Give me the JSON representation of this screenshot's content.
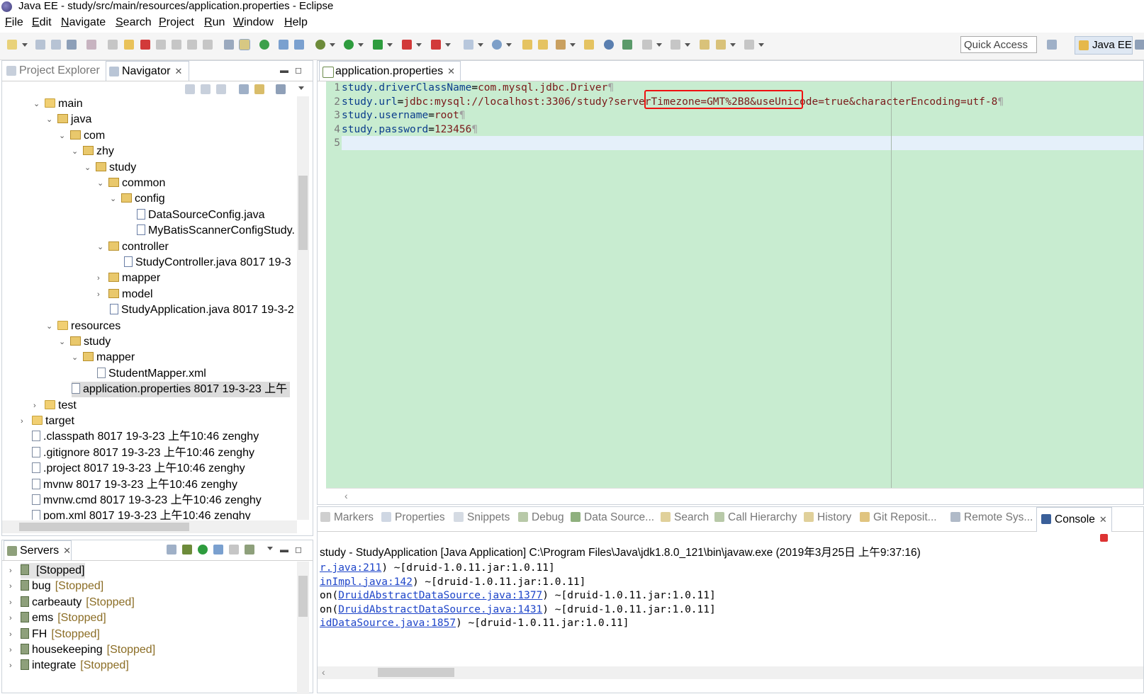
{
  "window": {
    "title": "Java EE - study/src/main/resources/application.properties - Eclipse"
  },
  "menu": [
    "File",
    "Edit",
    "Navigate",
    "Search",
    "Project",
    "Run",
    "Window",
    "Help"
  ],
  "toolbar": {
    "quick_access": "Quick Access",
    "perspective": "Java EE"
  },
  "nav": {
    "tabs": {
      "project_explorer": "Project Explorer",
      "navigator": "Navigator"
    },
    "tree": [
      {
        "label": "main",
        "tw": "v"
      },
      {
        "label": "java",
        "tw": "v"
      },
      {
        "label": "com",
        "tw": "v"
      },
      {
        "label": "zhy",
        "tw": "v"
      },
      {
        "label": "study",
        "tw": "v"
      },
      {
        "label": "common",
        "tw": "v"
      },
      {
        "label": "config",
        "tw": "v"
      },
      {
        "label": "DataSourceConfig.java",
        "tw": ""
      },
      {
        "label": "MyBatisScannerConfigStudy.",
        "tw": ""
      },
      {
        "label": "controller",
        "tw": "v"
      },
      {
        "label": "StudyController.java 8017  19-3",
        "tw": ""
      },
      {
        "label": "mapper",
        "tw": ">"
      },
      {
        "label": "model",
        "tw": ">"
      },
      {
        "label": "StudyApplication.java 8017  19-3-2",
        "tw": ""
      },
      {
        "label": "resources",
        "tw": "v"
      },
      {
        "label": "study",
        "tw": "v"
      },
      {
        "label": "mapper",
        "tw": "v"
      },
      {
        "label": "StudentMapper.xml",
        "tw": ""
      },
      {
        "label": "application.properties 8017  19-3-23 上午",
        "tw": ""
      },
      {
        "label": "test",
        "tw": ">"
      },
      {
        "label": "target",
        "tw": ">"
      },
      {
        "label": ".classpath 8017  19-3-23 上午10:46  zenghy",
        "tw": ""
      },
      {
        "label": ".gitignore 8017  19-3-23 上午10:46  zenghy",
        "tw": ""
      },
      {
        "label": ".project 8017  19-3-23 上午10:46  zenghy",
        "tw": ""
      },
      {
        "label": "mvnw 8017  19-3-23 上午10:46  zenghy",
        "tw": ""
      },
      {
        "label": "mvnw.cmd 8017  19-3-23 上午10:46  zenghy",
        "tw": ""
      },
      {
        "label": "pom.xml 8017  19-3-23 上午10:46  zenghy",
        "tw": ""
      }
    ]
  },
  "servers": {
    "tab": "Servers",
    "items": [
      {
        "name": "",
        "status": "[Stopped]"
      },
      {
        "name": "bug",
        "status": "[Stopped]"
      },
      {
        "name": "carbeauty",
        "status": "[Stopped]"
      },
      {
        "name": "ems",
        "status": "[Stopped]"
      },
      {
        "name": "FH",
        "status": "[Stopped]"
      },
      {
        "name": "housekeeping",
        "status": "[Stopped]"
      },
      {
        "name": "integrate",
        "status": "[Stopped]"
      }
    ]
  },
  "editor": {
    "tab": "application.properties",
    "lines": [
      {
        "n": "1",
        "key": "study.driverClassName",
        "eq": "=",
        "val": "com.mysql.jdbc.Driver",
        "p": "¶"
      },
      {
        "n": "2",
        "key": "study.url",
        "eq": "=",
        "val": "jdbc:mysql://localhost:3306/study?serverTimezone=GMT%2B8&useUnicode=true&characterEncoding=utf-8",
        "p": "¶"
      },
      {
        "n": "3",
        "key": "study.username",
        "eq": "=",
        "val": "root",
        "p": "¶"
      },
      {
        "n": "4",
        "key": "study.password",
        "eq": "=",
        "val": "123456",
        "p": "¶"
      },
      {
        "n": "5",
        "key": "",
        "eq": "",
        "val": "",
        "p": ""
      }
    ]
  },
  "bottom": {
    "tabs": [
      "Markers",
      "Properties",
      "Snippets",
      "Debug",
      "Data Source...",
      "Search",
      "Call Hierarchy",
      "History",
      "Git Reposit...",
      "Remote Sys..."
    ],
    "console_tab": "Console",
    "header": "study - StudyApplication [Java Application] C:\\Program Files\\Java\\jdk1.8.0_121\\bin\\javaw.exe (2019年3月25日 上午9:37:16)",
    "lines": [
      {
        "pre": "",
        "link": "r.java:211",
        "post": ") ~[druid-1.0.11.jar:1.0.11]"
      },
      {
        "pre": "",
        "link": "inImpl.java:142",
        "post": ") ~[druid-1.0.11.jar:1.0.11]"
      },
      {
        "pre": "on(",
        "link": "DruidAbstractDataSource.java:1377",
        "post": ") ~[druid-1.0.11.jar:1.0.11]"
      },
      {
        "pre": "on(",
        "link": "DruidAbstractDataSource.java:1431",
        "post": ") ~[druid-1.0.11.jar:1.0.11]"
      },
      {
        "pre": "",
        "link": "idDataSource.java:1857",
        "post": ") ~[druid-1.0.11.jar:1.0.11]"
      }
    ]
  }
}
